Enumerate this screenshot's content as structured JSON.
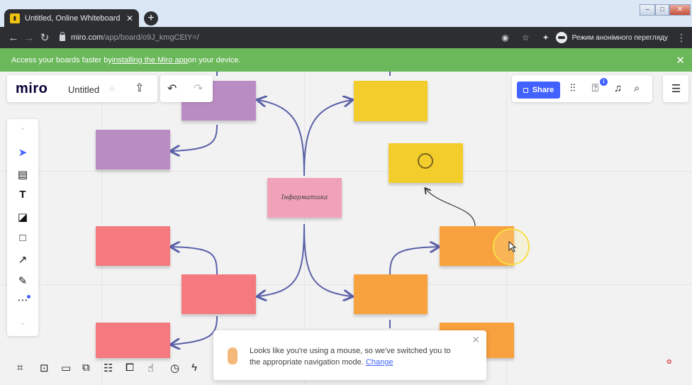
{
  "browser": {
    "tab_title": "Untitled, Online Whiteboard for",
    "tab_close": "✕",
    "new_tab": "+",
    "url_host": "miro.com",
    "url_path": "/app/board/o9J_kmgCEtY=/",
    "incognito_label": "Режим анонімного перегляду",
    "window_controls": [
      "–",
      "□",
      "✕"
    ]
  },
  "banner": {
    "prefix": "Access your boards faster by ",
    "link": "installing the Miro app",
    "suffix": " on your device.",
    "close": "✕"
  },
  "header": {
    "logo": "miro",
    "board_name": "Untitled",
    "star": "☆",
    "upload_icon": "⇪",
    "undo_icon": "↶",
    "redo_icon": "↷",
    "share_label": "Share",
    "notification_count": "1"
  },
  "board": {
    "center_note": "Інформатика"
  },
  "toast": {
    "message": "Looks like you're using a mouse, so we've switched you to the appropriate navigation mode.",
    "link": "Change",
    "close": "✕"
  },
  "icons": {
    "left_toolbar": [
      "select-arrow-icon",
      "templates-icon",
      "text-icon",
      "sticky-note-icon",
      "shape-icon",
      "connection-line-icon",
      "pen-icon",
      "more-tools-icon"
    ],
    "bottom_toolbar": [
      "frames-icon",
      "presentation-icon",
      "comments-icon",
      "chat-icon",
      "cards-icon",
      "share-screen-icon",
      "reactions-icon",
      "timer-icon",
      "voting-icon"
    ]
  },
  "colors": {
    "banner_green": "#6bb85b",
    "share_blue": "#4262ff",
    "purple_note": "#b98dc3",
    "yellow_note": "#f3cd2c",
    "red_note": "#f47a7f",
    "orange_note": "#f8a13f",
    "pink_note": "#f0a3b8",
    "connector": "#5b61a8"
  }
}
